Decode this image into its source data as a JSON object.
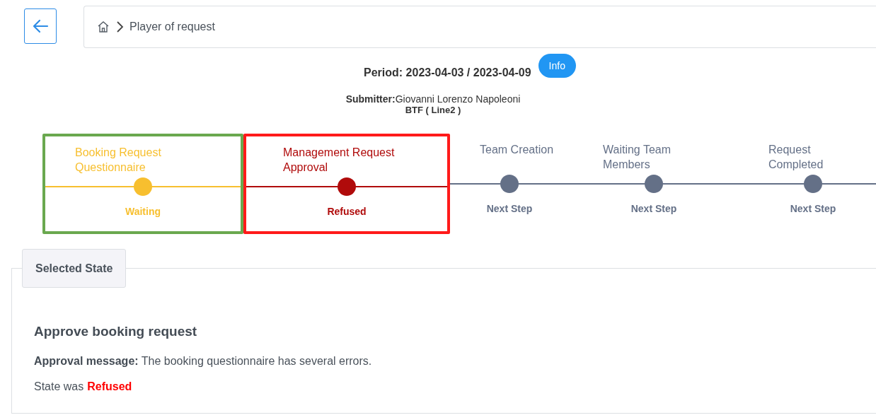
{
  "header": {
    "breadcrumb": "Player of request"
  },
  "summary": {
    "period": "Period: 2023-04-03 / 2023-04-09",
    "info_button": "Info",
    "submitter_label": "Submitter:",
    "submitter": "Giovanni Lorenzo Napoleoni",
    "line": "BTF ( Line2 )"
  },
  "steps": [
    {
      "label": "Booking Request Questionnaire",
      "status": "Waiting",
      "color": "#f7bf2f",
      "frame": {
        "color": "#6aa84f"
      }
    },
    {
      "label": "Management Request Approval",
      "status": "Refused",
      "color": "#b00b0b",
      "frame": {
        "color": "#ff1a1a"
      }
    },
    {
      "label": "Team Creation",
      "status": "Next Step",
      "color": "#647087"
    },
    {
      "label": "Waiting Team Members",
      "status": "Next Step",
      "color": "#647087"
    },
    {
      "label": "Request Completed",
      "status": "Next Step",
      "color": "#647087"
    }
  ],
  "panel": {
    "tab": "Selected State",
    "title": "Approve booking request",
    "message": "**Approval message:** The booking questionnaire has several errors.",
    "state_prefix": "State was",
    "state": "Refused"
  }
}
